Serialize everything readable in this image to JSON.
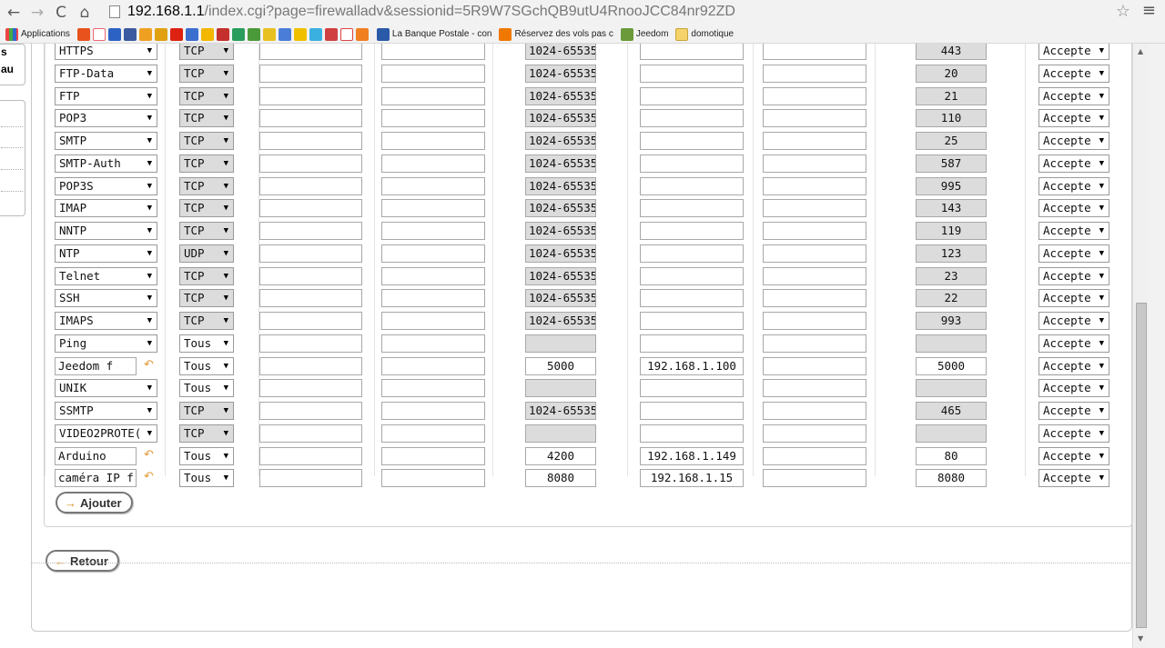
{
  "browser": {
    "url_host": "192.168.1.1",
    "url_path": "/index.cgi?page=firewalladv&sessionid=5R9W7SGchQB9utU4RnooJCC84nr92ZD",
    "bookmarks": {
      "apps": "Applications",
      "banque": "La Banque Postale - con",
      "reservez": "Réservez des vols pas c",
      "jeedom": "Jeedom",
      "domotique": "domotique"
    }
  },
  "sidebar": {
    "label": "au",
    "label_top": "s"
  },
  "rules": [
    {
      "service": "HTTPS",
      "proto": "TCP",
      "range": "1024-65535",
      "port": "443",
      "action": "Accepte"
    },
    {
      "service": "FTP-Data",
      "proto": "TCP",
      "range": "1024-65535",
      "port": "20",
      "action": "Accepte"
    },
    {
      "service": "FTP",
      "proto": "TCP",
      "range": "1024-65535",
      "port": "21",
      "action": "Accepte"
    },
    {
      "service": "POP3",
      "proto": "TCP",
      "range": "1024-65535",
      "port": "110",
      "action": "Accepte"
    },
    {
      "service": "SMTP",
      "proto": "TCP",
      "range": "1024-65535",
      "port": "25",
      "action": "Accepte"
    },
    {
      "service": "SMTP-Auth",
      "proto": "TCP",
      "range": "1024-65535",
      "port": "587",
      "action": "Accepte"
    },
    {
      "service": "POP3S",
      "proto": "TCP",
      "range": "1024-65535",
      "port": "995",
      "action": "Accepte"
    },
    {
      "service": "IMAP",
      "proto": "TCP",
      "range": "1024-65535",
      "port": "143",
      "action": "Accepte"
    },
    {
      "service": "NNTP",
      "proto": "TCP",
      "range": "1024-65535",
      "port": "119",
      "action": "Accepte"
    },
    {
      "service": "NTP",
      "proto": "UDP",
      "range": "1024-65535",
      "port": "123",
      "action": "Accepte"
    },
    {
      "service": "Telnet",
      "proto": "TCP",
      "range": "1024-65535",
      "port": "23",
      "action": "Accepte"
    },
    {
      "service": "SSH",
      "proto": "TCP",
      "range": "1024-65535",
      "port": "22",
      "action": "Accepte"
    },
    {
      "service": "IMAPS",
      "proto": "TCP",
      "range": "1024-65535",
      "port": "993",
      "action": "Accepte"
    },
    {
      "service": "Ping",
      "proto": "Tous",
      "range": "",
      "port": "",
      "action": "Accepte"
    },
    {
      "service": "Jeedom f",
      "custom": true,
      "proto": "Tous",
      "range": "5000",
      "ip": "192.168.1.100",
      "port": "5000",
      "action": "Accepte"
    },
    {
      "service": "UNIK",
      "proto": "Tous",
      "range": "",
      "port": "",
      "action": "Accepte"
    },
    {
      "service": "SSMTP",
      "proto": "TCP",
      "range": "1024-65535",
      "port": "465",
      "action": "Accepte"
    },
    {
      "service": "VIDEO2PROTE(",
      "proto": "TCP",
      "range": "",
      "port": "",
      "action": "Accepte"
    },
    {
      "service": "Arduino",
      "custom": true,
      "proto": "Tous",
      "range": "4200",
      "ip": "192.168.1.149",
      "port": "80",
      "action": "Accepte"
    },
    {
      "service": "caméra IP f",
      "custom": true,
      "proto": "Tous",
      "range": "8080",
      "ip": "192.168.1.15",
      "port": "8080",
      "action": "Accepte"
    }
  ],
  "buttons": {
    "add": "Ajouter",
    "back": "Retour"
  }
}
